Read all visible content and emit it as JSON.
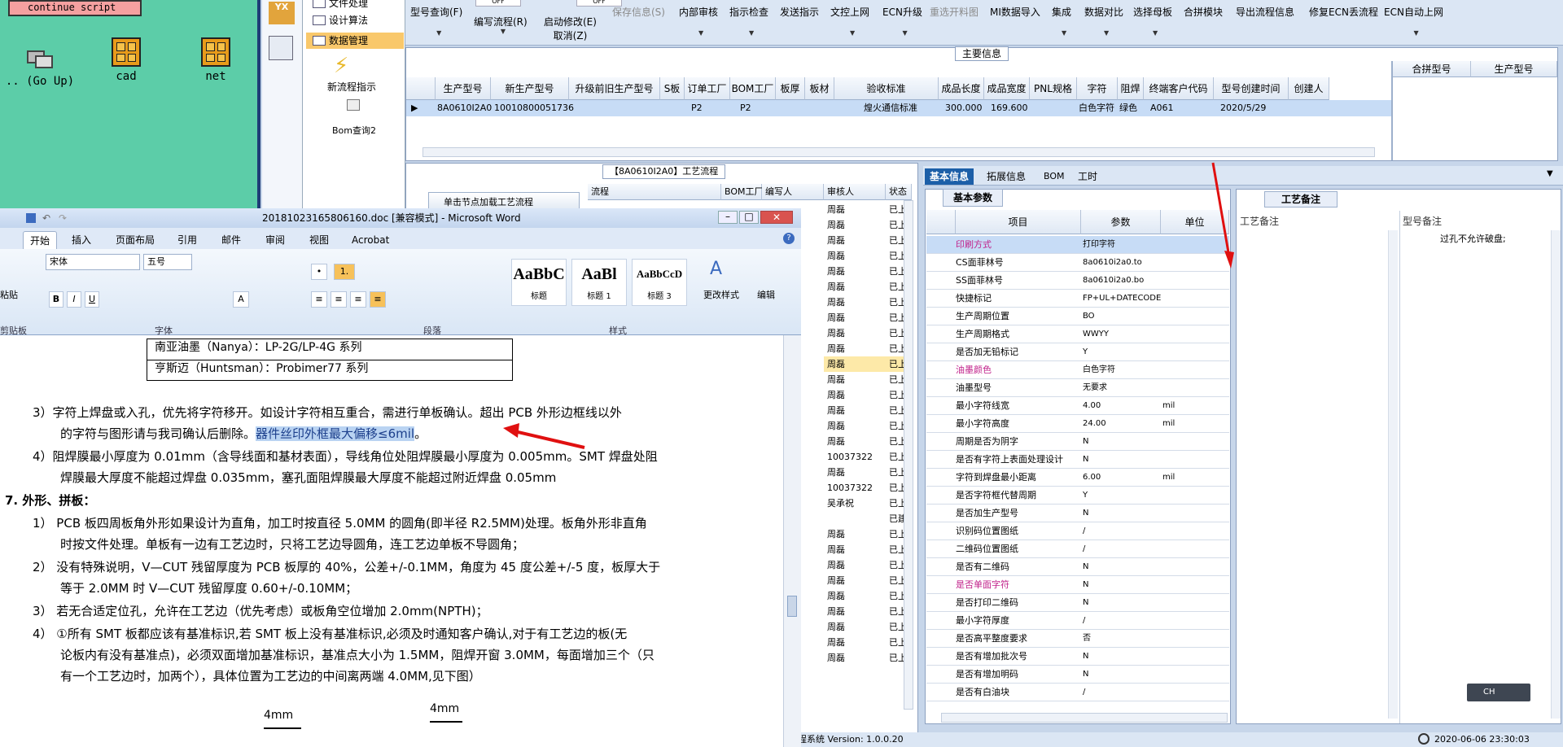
{
  "desktop": {
    "continue_label": "continue script",
    "icons": [
      ".. (Go Up)",
      "cad",
      "net"
    ]
  },
  "nav": {
    "items": [
      "文件处理",
      "设计算法",
      "数据管理"
    ],
    "new_process": "新流程指示",
    "bom_query": "Bom查询2",
    "toggle": "OFF"
  },
  "toolbar": {
    "items": [
      {
        "label": "型号查询(F)",
        "disabled": false
      },
      {
        "label": "编写流程(R)",
        "disabled": false
      },
      {
        "label": "启动修改(E)",
        "sub": "取消(Z)",
        "disabled": false
      },
      {
        "label": "保存信息(S)",
        "disabled": true
      },
      {
        "label": "内部审核",
        "disabled": false
      },
      {
        "label": "指示检查",
        "disabled": false
      },
      {
        "label": "发送指示",
        "disabled": false
      },
      {
        "label": "文控上网",
        "disabled": false
      },
      {
        "label": "ECN升级",
        "disabled": false
      },
      {
        "label": "重选开料图",
        "disabled": true
      },
      {
        "label": "MI数据导入",
        "disabled": false
      },
      {
        "label": "集成",
        "disabled": false
      },
      {
        "label": "数据对比",
        "disabled": false
      },
      {
        "label": "选择母板",
        "disabled": false
      },
      {
        "label": "合拼模块",
        "disabled": false
      },
      {
        "label": "导出流程信息",
        "disabled": false
      },
      {
        "label": "修复ECN丢流程",
        "disabled": false
      },
      {
        "label": "ECN自动上网",
        "disabled": false
      }
    ]
  },
  "main_info": {
    "title": "主要信息",
    "columns": [
      "生产型号",
      "新生产型号",
      "升级前旧生产型号",
      "S板",
      "订单工厂",
      "BOM工厂",
      "板厚",
      "板材",
      "验收标准",
      "成品长度",
      "成品宽度",
      "PNL规格",
      "字符",
      "阻焊",
      "终端客户代码",
      "型号创建时间",
      "创建人"
    ],
    "row": [
      "8A0610I2A0",
      "10010800051736",
      "",
      "",
      "P2",
      "P2",
      "",
      "",
      "煌火通信标准",
      "300.000",
      "169.600",
      "",
      "白色字符",
      "绿色",
      "A061",
      "2020/5/29",
      ""
    ],
    "side_columns": [
      "合拼型号",
      "生产型号"
    ]
  },
  "process": {
    "title": "【8A0610I2A0】工艺流程",
    "button": "单击节点加载工艺流程",
    "columns": [
      "流程",
      "BOM工厂",
      "编写人",
      "审核人",
      "状态"
    ],
    "reviewer": "周磊",
    "status": "已上",
    "row_ids": [
      "10037322",
      "10037322"
    ],
    "writer2": "吴承祝",
    "status2": "已建"
  },
  "right_tabs": [
    "基本信息",
    "拓展信息",
    "BOM",
    "工时"
  ],
  "basic_params": {
    "title": "基本参数",
    "columns": [
      "项目",
      "参数",
      "单位"
    ],
    "rows": [
      {
        "name": "印刷方式",
        "value": "打印字符",
        "unit": "",
        "pink": true
      },
      {
        "name": "CS面菲林号",
        "value": "8a0610i2a0.to",
        "unit": ""
      },
      {
        "name": "SS面菲林号",
        "value": "8a0610i2a0.bo",
        "unit": ""
      },
      {
        "name": "快捷标记",
        "value": "FP+UL+DATECODE",
        "unit": ""
      },
      {
        "name": "生产周期位置",
        "value": "BO",
        "unit": ""
      },
      {
        "name": "生产周期格式",
        "value": "WWYY",
        "unit": ""
      },
      {
        "name": "是否加无铅标记",
        "value": "Y",
        "unit": ""
      },
      {
        "name": "油墨颜色",
        "value": "白色字符",
        "unit": "",
        "pink": true
      },
      {
        "name": "油墨型号",
        "value": "无要求",
        "unit": ""
      },
      {
        "name": "最小字符线宽",
        "value": "4.00",
        "unit": "mil"
      },
      {
        "name": "最小字符高度",
        "value": "24.00",
        "unit": "mil"
      },
      {
        "name": "周期是否为阴字",
        "value": "N",
        "unit": ""
      },
      {
        "name": "是否有字符上表面处理设计",
        "value": "N",
        "unit": ""
      },
      {
        "name": "字符到焊盘最小距离",
        "value": "6.00",
        "unit": "mil"
      },
      {
        "name": "是否字符框代替周期",
        "value": "Y",
        "unit": ""
      },
      {
        "name": "是否加生产型号",
        "value": "N",
        "unit": ""
      },
      {
        "name": "识别码位置图纸",
        "value": "/",
        "unit": ""
      },
      {
        "name": "二维码位置图纸",
        "value": "/",
        "unit": ""
      },
      {
        "name": "是否有二维码",
        "value": "N",
        "unit": ""
      },
      {
        "name": "是否单面字符",
        "value": "N",
        "unit": "",
        "pink": true
      },
      {
        "name": "是否打印二维码",
        "value": "N",
        "unit": ""
      },
      {
        "name": "最小字符厚度",
        "value": "/",
        "unit": ""
      },
      {
        "name": "是否高平整度要求",
        "value": "否",
        "unit": ""
      },
      {
        "name": "是否有增加批次号",
        "value": "N",
        "unit": ""
      },
      {
        "name": "是否有增加明码",
        "value": "N",
        "unit": ""
      },
      {
        "name": "是否有白油块",
        "value": "/",
        "unit": ""
      }
    ]
  },
  "notes": {
    "tab": "工艺备注",
    "col1": "工艺备注",
    "col2": "型号备注",
    "model_note": "过孔不允许破盘;"
  },
  "ime": "CH",
  "status": {
    "version": "程系统 Version: 1.0.0.20",
    "datetime": "2020-06-06 23:30:03"
  },
  "word": {
    "title": "20181023165806160.doc [兼容模式] - Microsoft Word",
    "tabs": [
      "开始",
      "插入",
      "页面布局",
      "引用",
      "邮件",
      "审阅",
      "视图",
      "Acrobat"
    ],
    "font": "宋体",
    "size": "五号",
    "groups": [
      "剪贴板",
      "字体",
      "段落",
      "样式",
      "编辑"
    ],
    "paste": "粘贴",
    "styles": [
      {
        "preview": "AaBbC",
        "name": "标题"
      },
      {
        "preview": "AaBl",
        "name": "标题 1"
      },
      {
        "preview": "AaBbCcD",
        "name": "标题 3"
      }
    ],
    "change_style": "更改样式",
    "edit": "编辑",
    "table_rows": [
      "南亚油墨（Nanya）：LP-2G/LP-4G 系列",
      "亨斯迈（Huntsman）：Probimer77 系列"
    ],
    "p3_a": "3）字符上焊盘或入孔，优先将字符移开。如设计字符相互重合，需进行单板确认。超出 PCB 外形边框线以外",
    "p3_b": "的字符与图形请与我司确认后删除。",
    "p3_hl": "器件丝印外框最大偏移≤6mil",
    "p3_end": "。",
    "p4_a": "4）阻焊膜最小厚度为 0.01mm（含导线面和基材表面），导线角位处阻焊膜最小厚度为 0.005mm。SMT 焊盘处阻",
    "p4_b": "焊膜最大厚度不能超过焊盘 0.035mm，塞孔面阻焊膜最大厚度不能超过附近焊盘 0.05mm",
    "s7": "7.   外形、拼板：",
    "l1a": "1） PCB 板四周板角外形如果设计为直角，加工时按直径 5.0MM 的圆角(即半径 R2.5MM)处理。板角外形非直角",
    "l1b": "时按文件处理。单板有一边有工艺边时，只将工艺边导圆角，连工艺边单板不导圆角；",
    "l2a": "2） 没有特殊说明，V—CUT 残留厚度为 PCB 板厚的 40%，公差+/-0.1MM，角度为 45 度公差+/-5 度，板厚大于",
    "l2b": "等于 2.0MM 时 V—CUT 残留厚度 0.60+/-0.10MM；",
    "l3": "3） 若无合适定位孔，允许在工艺边（优先考虑）或板角空位增加 2.0mm(NPTH)；",
    "l4a": "4） ①所有 SMT 板都应该有基准标识,若 SMT 板上没有基准标识,必须及时通知客户确认,对于有工艺边的板(无",
    "l4b": "论板内有没有基准点)，必须双面增加基准标识，基准点大小为 1.5MM，阻焊开窗 3.0MM，每面增加三个（只",
    "l4c": "有一个工艺边时，加两个），具体位置为工艺边的中间离两端 4.0MM,见下图）",
    "dim1": "4mm",
    "dim2": "4mm"
  },
  "colors": {
    "accent": "#1c5fa8",
    "desktop": "#5ccda8",
    "highlight": "#b9d3f2",
    "arrow": "#e01010"
  }
}
